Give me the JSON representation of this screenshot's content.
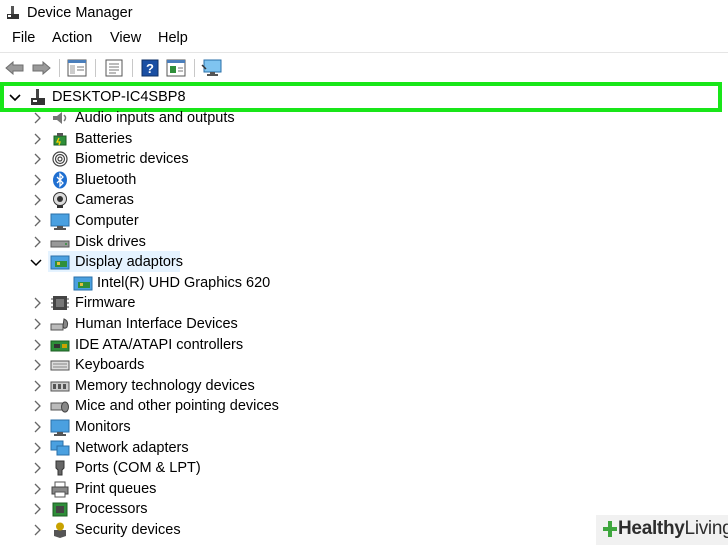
{
  "window": {
    "title": "Device Manager"
  },
  "menu": [
    "File",
    "Action",
    "View",
    "Help"
  ],
  "toolbar": {
    "buttons": [
      "back-icon",
      "forward-icon",
      "properties-pane-icon",
      "details-icon",
      "help-icon",
      "show-hide-icon",
      "monitor-scan-icon"
    ]
  },
  "tree": {
    "root": "DESKTOP-IC4SBP8",
    "items": [
      {
        "label": "Audio inputs and outputs",
        "icon": "speaker-icon"
      },
      {
        "label": "Batteries",
        "icon": "battery-icon"
      },
      {
        "label": "Biometric devices",
        "icon": "fingerprint-icon"
      },
      {
        "label": "Bluetooth",
        "icon": "bluetooth-icon"
      },
      {
        "label": "Cameras",
        "icon": "camera-icon"
      },
      {
        "label": "Computer",
        "icon": "computer-icon"
      },
      {
        "label": "Disk drives",
        "icon": "disk-drive-icon"
      },
      {
        "label": "Display adaptors",
        "icon": "display-adapter-icon",
        "expanded": true,
        "children": [
          {
            "label": "Intel(R) UHD Graphics 620",
            "icon": "display-adapter-icon"
          }
        ]
      },
      {
        "label": "Firmware",
        "icon": "firmware-icon"
      },
      {
        "label": "Human Interface Devices",
        "icon": "hid-icon"
      },
      {
        "label": "IDE ATA/ATAPI controllers",
        "icon": "ide-controller-icon"
      },
      {
        "label": "Keyboards",
        "icon": "keyboard-icon"
      },
      {
        "label": "Memory technology devices",
        "icon": "memory-icon"
      },
      {
        "label": "Mice and other pointing devices",
        "icon": "mouse-icon"
      },
      {
        "label": "Monitors",
        "icon": "monitor-icon"
      },
      {
        "label": "Network adapters",
        "icon": "network-icon"
      },
      {
        "label": "Ports (COM & LPT)",
        "icon": "port-icon"
      },
      {
        "label": "Print queues",
        "icon": "printer-icon"
      },
      {
        "label": "Processors",
        "icon": "processor-icon"
      },
      {
        "label": "Security devices",
        "icon": "security-icon"
      }
    ]
  },
  "watermark": {
    "bold": "Healthy",
    "light": "Living"
  },
  "colors": {
    "highlight_border": "#19e619",
    "selection": "#e5f3ff",
    "watermark_plus": "#3ea63e"
  }
}
